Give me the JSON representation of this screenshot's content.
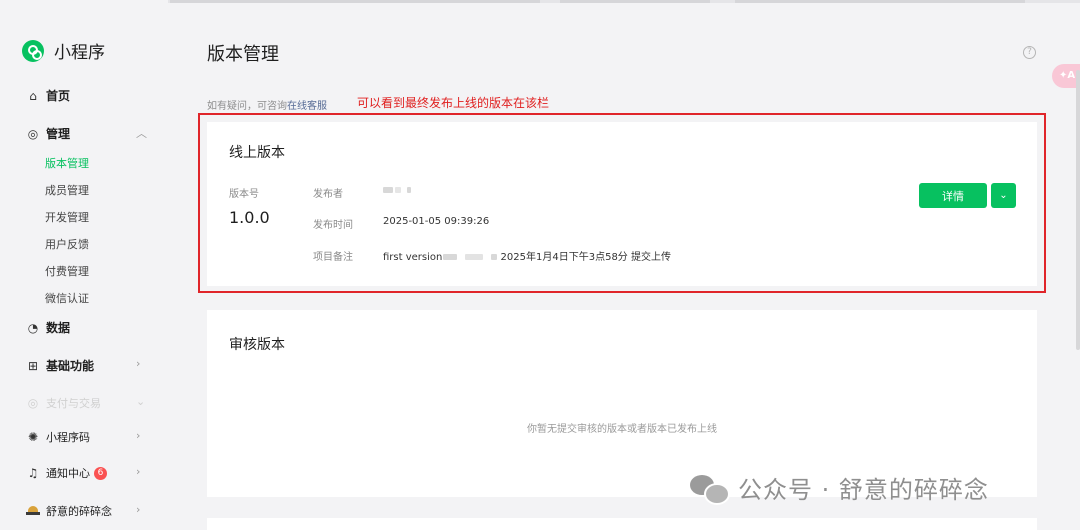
{
  "brand": {
    "name": "小程序"
  },
  "sidebar": {
    "home": {
      "label": "首页",
      "icon": "home-icon"
    },
    "manage": {
      "label": "管理",
      "icon": "settings-icon",
      "children": [
        "版本管理",
        "成员管理",
        "开发管理",
        "用户反馈",
        "付费管理",
        "微信认证"
      ],
      "active_index": 0
    },
    "data": {
      "label": "数据",
      "icon": "pie-chart-icon"
    },
    "basic": {
      "label": "基础功能",
      "icon": "grid-icon"
    },
    "pay": {
      "label": "支付与交易"
    },
    "qrcode": {
      "label": "小程序码",
      "icon": "sun-code-icon"
    },
    "notice": {
      "label": "通知中心",
      "icon": "bell-icon",
      "badge": "6"
    },
    "account": {
      "label": "舒意的碎碎念"
    }
  },
  "main": {
    "title": "版本管理",
    "help_text": "如有疑问，可咨询",
    "help_link": "在线客服",
    "annotation": "可以看到最终发布上线的版本在该栏",
    "online": {
      "title": "线上版本",
      "version_label": "版本号",
      "version": "1.0.0",
      "publisher_label": "发布者",
      "time_label": "发布时间",
      "time": "2025-01-05 09:39:26",
      "note_label": "项目备注",
      "note_prefix": "first version",
      "note_suffix": "2025年1月4日下午3点58分 提交上传",
      "detail_button": "详情",
      "more_button": "⌄"
    },
    "review": {
      "title": "审核版本",
      "empty_text": "你暂无提交审核的版本或者版本已发布上线"
    }
  },
  "watermark": {
    "text": "公众号 · 舒意的碎碎念"
  },
  "colors": {
    "accent": "#07c160",
    "annotation": "#e0252a",
    "badge": "#fa5151"
  }
}
